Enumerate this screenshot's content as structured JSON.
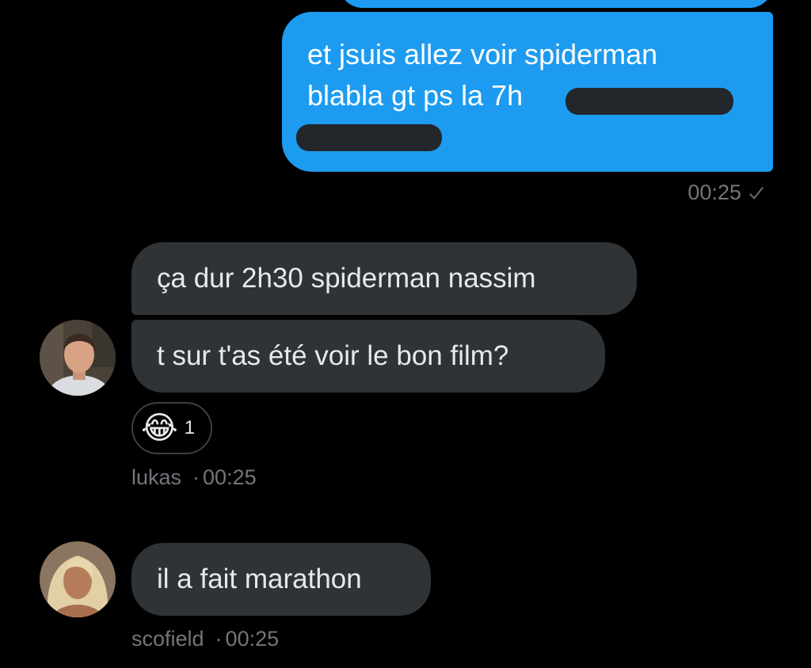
{
  "colors": {
    "background": "#000000",
    "outgoing_bubble": "#1d9bf0",
    "incoming_bubble": "#2f3336",
    "meta_text": "#71767b"
  },
  "outgoing": {
    "line1": "et jsuis allez voir spiderman",
    "line2": "blabla gt ps la 7h",
    "time": "00:25",
    "status_icon": "check-icon"
  },
  "incoming_1": {
    "message1": "ça dur 2h30 spiderman nassim",
    "message2": "t sur t'as été voir le bon film?",
    "reaction_emoji": "😂",
    "reaction_count": "1",
    "sender": "lukas",
    "separator": "·",
    "time": "00:25"
  },
  "incoming_2": {
    "message": "il a fait marathon",
    "sender": "scofield",
    "separator": "·",
    "time": "00:25"
  }
}
